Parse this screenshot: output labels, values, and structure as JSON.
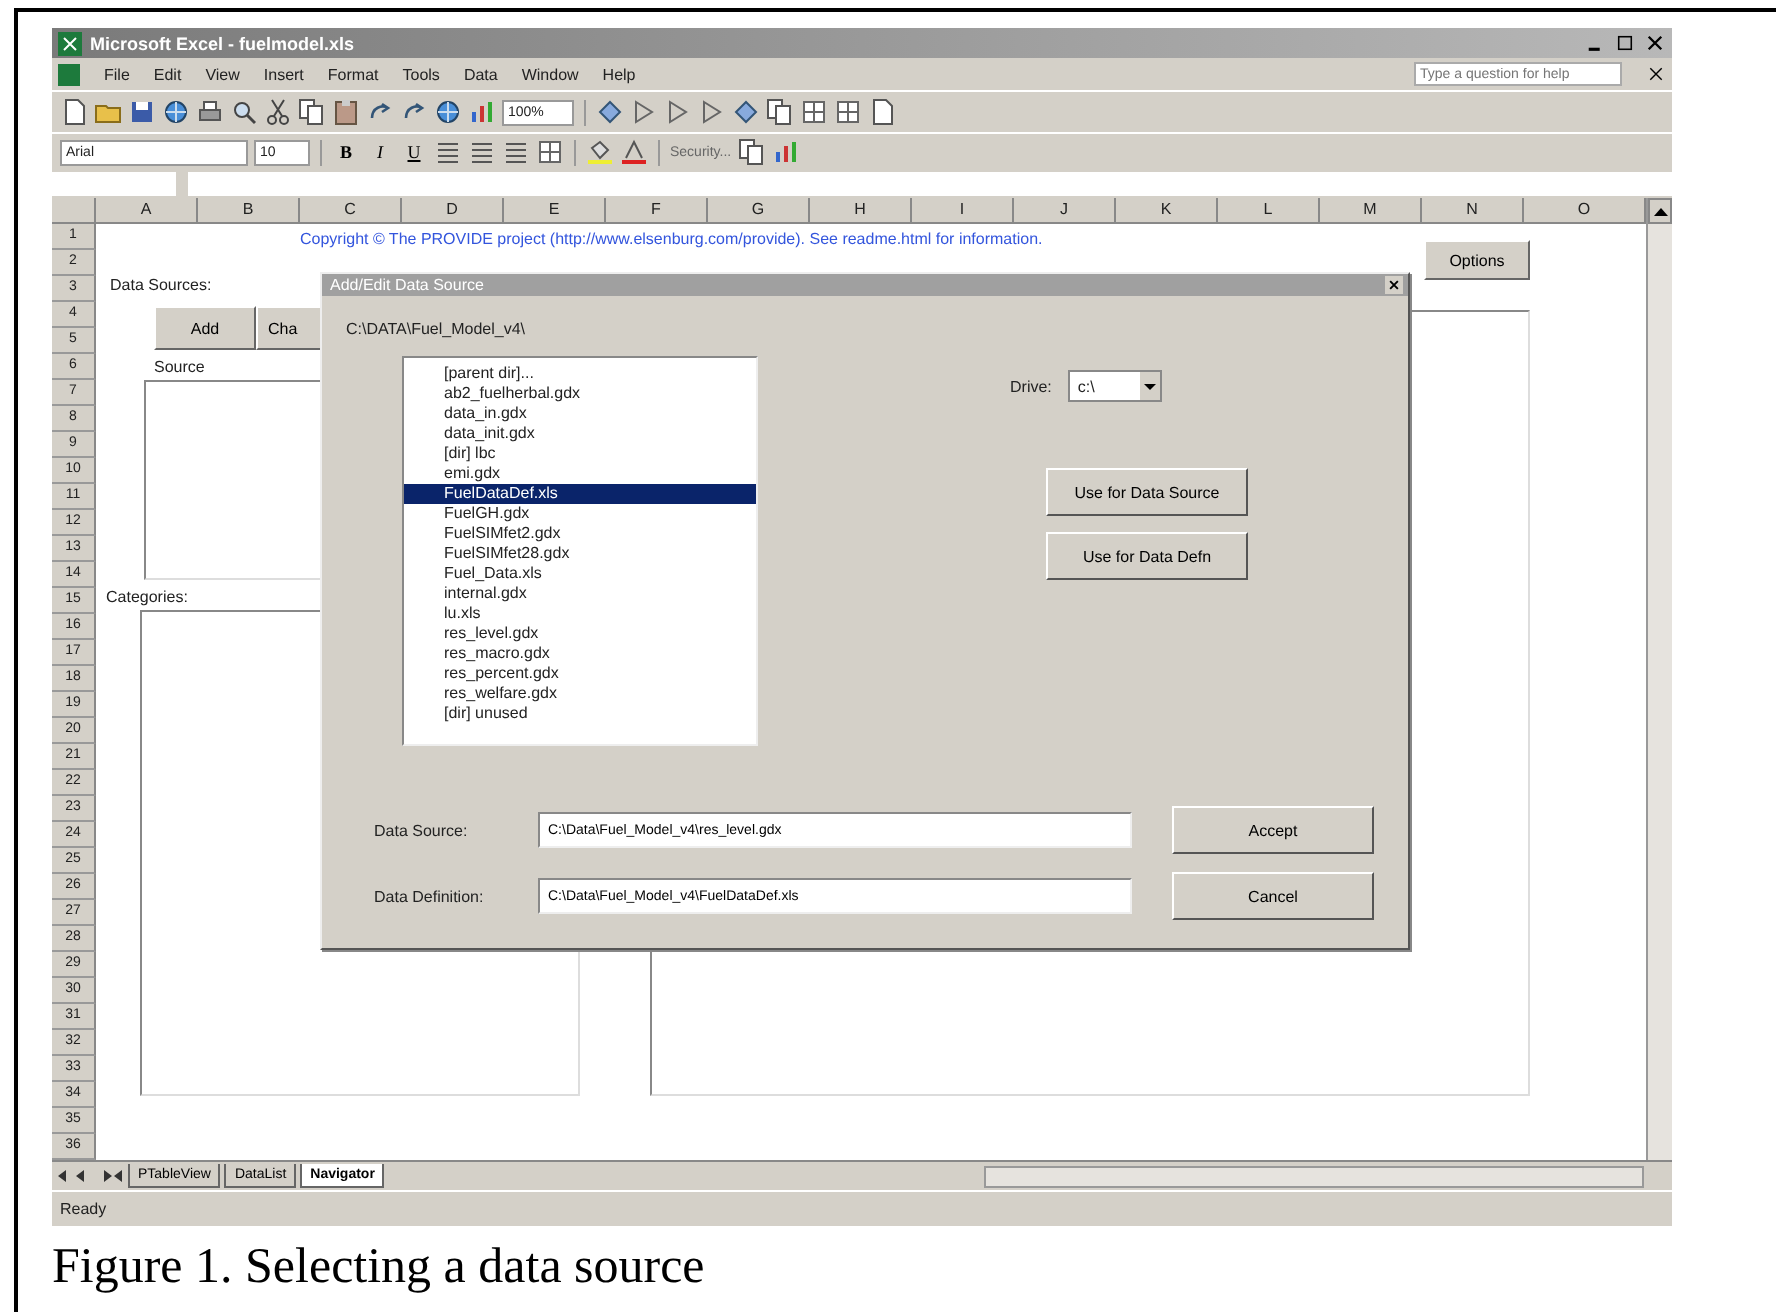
{
  "window": {
    "title": "Microsoft Excel - fuelmodel.xls"
  },
  "menu": [
    "File",
    "Edit",
    "View",
    "Insert",
    "Format",
    "Tools",
    "Data",
    "Window",
    "Help"
  ],
  "help_box": {
    "placeholder": "Type a question for help"
  },
  "toolbar": {
    "zoom": "100%",
    "font": "Arial",
    "font_size": "10",
    "format_buttons": [
      "B",
      "I",
      "U"
    ],
    "security": "Security..."
  },
  "columns": [
    "A",
    "B",
    "C",
    "D",
    "E",
    "F",
    "G",
    "H",
    "I",
    "J",
    "K",
    "L",
    "M",
    "N",
    "O"
  ],
  "rows": [
    "1",
    "2",
    "3",
    "4",
    "5",
    "6",
    "7",
    "8",
    "9",
    "10",
    "11",
    "12",
    "13",
    "14",
    "15",
    "16",
    "17",
    "18",
    "19",
    "20",
    "21",
    "22",
    "23",
    "24",
    "25",
    "26",
    "27",
    "28",
    "29",
    "30",
    "31",
    "32",
    "33",
    "34",
    "35",
    "36"
  ],
  "sheet": {
    "copyright": "Copyright © The PROVIDE project (http://www.elsenburg.com/provide). See readme.html for information.",
    "options_button": "Options",
    "data_sources_label": "Data Sources:",
    "add_button": "Add",
    "change_button": "Cha",
    "source_label": "Source",
    "categories_label": "Categories:"
  },
  "dialog": {
    "title": "Add/Edit Data Source",
    "path": "C:\\DATA\\Fuel_Model_v4\\",
    "files": [
      {
        "name": "[parent dir]...",
        "selected": false
      },
      {
        "name": "ab2_fuelherbal.gdx",
        "selected": false
      },
      {
        "name": "data_in.gdx",
        "selected": false
      },
      {
        "name": "data_init.gdx",
        "selected": false
      },
      {
        "name": "[dir] lbc",
        "selected": false
      },
      {
        "name": "emi.gdx",
        "selected": false
      },
      {
        "name": "FuelDataDef.xls",
        "selected": true
      },
      {
        "name": "FuelGH.gdx",
        "selected": false
      },
      {
        "name": "FuelSIMfet2.gdx",
        "selected": false
      },
      {
        "name": "FuelSIMfet28.gdx",
        "selected": false
      },
      {
        "name": "Fuel_Data.xls",
        "selected": false
      },
      {
        "name": "internal.gdx",
        "selected": false
      },
      {
        "name": "lu.xls",
        "selected": false
      },
      {
        "name": "res_level.gdx",
        "selected": false
      },
      {
        "name": "res_macro.gdx",
        "selected": false
      },
      {
        "name": "res_percent.gdx",
        "selected": false
      },
      {
        "name": "res_welfare.gdx",
        "selected": false
      },
      {
        "name": "[dir] unused",
        "selected": false
      }
    ],
    "drive_label": "Drive:",
    "drive": "c:\\",
    "use_source_button": "Use for Data Source",
    "use_defn_button": "Use for Data Defn",
    "data_source_label": "Data Source:",
    "data_source": "C:\\Data\\Fuel_Model_v4\\res_level.gdx",
    "data_definition_label": "Data Definition:",
    "data_definition": "C:\\Data\\Fuel_Model_v4\\FuelDataDef.xls",
    "accept_button": "Accept",
    "cancel_button": "Cancel"
  },
  "sheet_tabs": [
    {
      "label": "PTableView",
      "selected": false
    },
    {
      "label": "DataList",
      "selected": false
    },
    {
      "label": "Navigator",
      "selected": true
    }
  ],
  "status_bar": "Ready",
  "caption": "Figure 1. Selecting a data source"
}
